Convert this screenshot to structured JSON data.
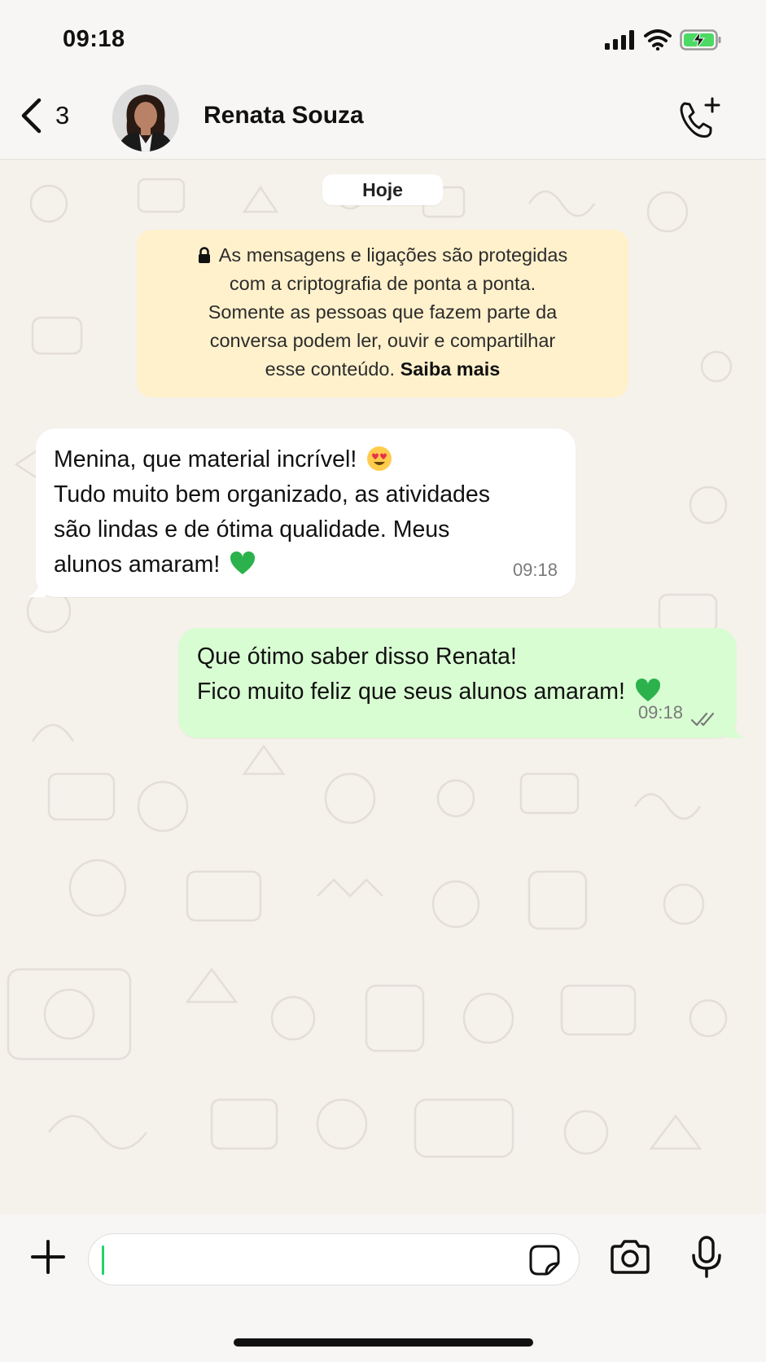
{
  "status_bar": {
    "time": "09:18"
  },
  "header": {
    "back_count": "3",
    "contact_name": "Renata Souza"
  },
  "date_chip": "Hoje",
  "encryption_notice": {
    "lines": [
      "As mensagens e ligações são protegidas",
      "com a criptografia de ponta a ponta.",
      "Somente as pessoas que fazem parte da",
      "conversa podem ler, ouvir e compartilhar",
      "esse conteúdo."
    ],
    "learn_more": "Saiba mais"
  },
  "messages": [
    {
      "direction": "incoming",
      "lines": [
        "Menina, que material incrível!",
        "Tudo muito bem organizado, as atividades",
        "são lindas e de ótima qualidade. Meus",
        "alunos amaram!"
      ],
      "emojis": [
        "smiling-face-with-heart-eyes",
        "green-heart"
      ],
      "time": "09:18"
    },
    {
      "direction": "outgoing",
      "lines": [
        "Que ótimo saber disso Renata!",
        "Fico muito feliz que seus alunos amaram!"
      ],
      "emojis": [
        "green-heart"
      ],
      "time": "09:18",
      "status": "read"
    }
  ],
  "input": {
    "value": ""
  },
  "colors": {
    "wallpaper": "#f5f1eb",
    "incoming_bubble": "#ffffff",
    "outgoing_bubble": "#d9fdd3",
    "notice": "#fff1cc",
    "accent": "#25d366",
    "battery": "#4cd964"
  }
}
